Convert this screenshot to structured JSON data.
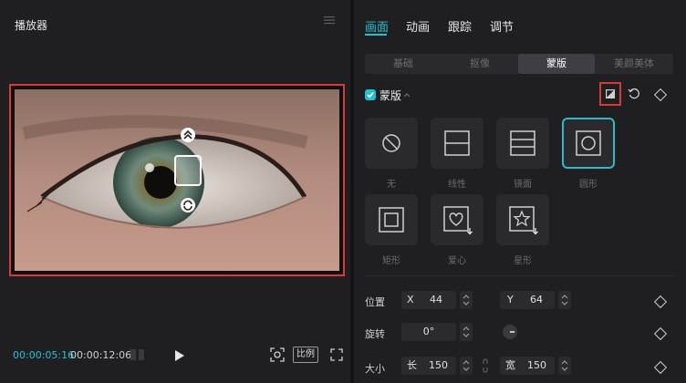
{
  "player": {
    "title": "播放器",
    "time_current": "00:00:05:16",
    "time_total": "00:00:12:06",
    "ratio_label": "比例"
  },
  "tabs": [
    "画面",
    "动画",
    "跟踪",
    "调节"
  ],
  "subtabs": [
    "基础",
    "抠像",
    "蒙版",
    "美颜美体"
  ],
  "mask": {
    "section_label": "蒙版",
    "shapes": [
      {
        "label": "无",
        "icon": "none-circle-icon"
      },
      {
        "label": "线性",
        "icon": "linear-mask-icon"
      },
      {
        "label": "镜面",
        "icon": "mirror-mask-icon"
      },
      {
        "label": "圆形",
        "icon": "circle-mask-icon"
      },
      {
        "label": "矩形",
        "icon": "rectangle-mask-icon"
      },
      {
        "label": "爱心",
        "icon": "heart-mask-icon"
      },
      {
        "label": "星形",
        "icon": "star-mask-icon"
      }
    ]
  },
  "position": {
    "label": "位置",
    "x_label": "X",
    "x_value": "44",
    "y_label": "Y",
    "y_value": "64"
  },
  "rotation": {
    "label": "旋转",
    "value": "0°"
  },
  "size": {
    "label": "大小",
    "w_label": "长",
    "w_value": "150",
    "h_label": "宽",
    "h_value": "150"
  },
  "colors": {
    "accent": "#26c0d3",
    "highlight": "#d63b3b",
    "panel": "#1f1f22"
  }
}
